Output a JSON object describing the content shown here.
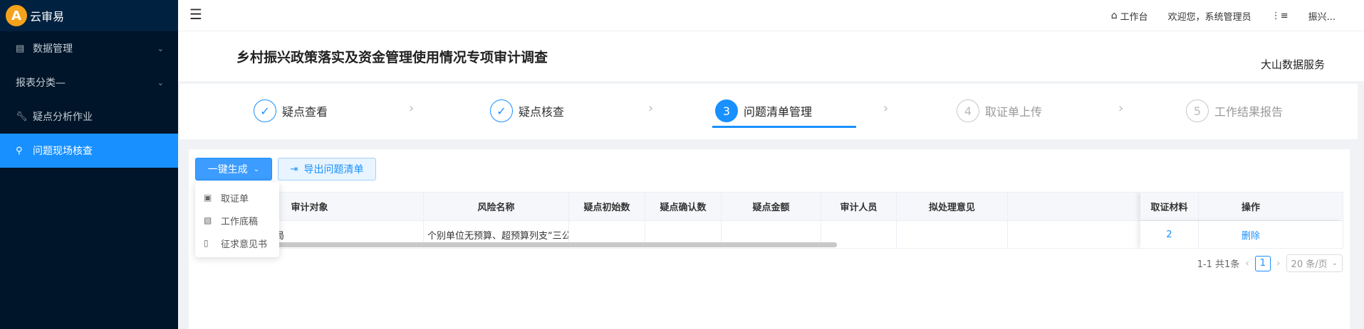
{
  "sidebar": {
    "logo_text": "云审易",
    "items": [
      {
        "label": "数据管理",
        "has_arrow": true
      },
      {
        "label": "报表分类—",
        "has_arrow": true
      },
      {
        "label": "疑点分析作业",
        "has_arrow": false
      },
      {
        "label": "问题现场核查",
        "has_arrow": false,
        "active": true
      }
    ]
  },
  "header": {
    "workbench": "工作台",
    "welcome": "欢迎您，系统管理员",
    "username": "振兴..."
  },
  "page": {
    "title": "乡村振兴政策落实及资金管理使用情况专项审计调查",
    "company": "大山数据服务"
  },
  "steps": [
    {
      "num": "✓",
      "label": "疑点查看",
      "state": "done"
    },
    {
      "num": "✓",
      "label": "疑点核查",
      "state": "done"
    },
    {
      "num": "3",
      "label": "问题清单管理",
      "state": "current"
    },
    {
      "num": "4",
      "label": "取证单上传",
      "state": "wait"
    },
    {
      "num": "5",
      "label": "工作结果报告",
      "state": "wait"
    }
  ],
  "toolbar": {
    "generate_label": "一键生成",
    "export_label": "导出问题清单"
  },
  "dropdown": {
    "items": [
      "取证单",
      "工作底稿",
      "征求意见书"
    ]
  },
  "table": {
    "columns": [
      "审计对象",
      "风险名称",
      "疑点初始数",
      "疑点确认数",
      "疑点金额",
      "审计人员",
      "拟处理意见",
      "取证材料",
      "操作"
    ],
    "rows": [
      {
        "audit_object": "政局",
        "risk_name": "个别单位无预算、超预算列支“三公”经",
        "initial": "",
        "confirmed": "",
        "amount": "",
        "auditor": "",
        "opinion": "",
        "evidence": "2",
        "action": "删除"
      }
    ]
  },
  "pagination": {
    "summary": "1-1 共1条",
    "current_page": "1",
    "page_size": "20 条/页"
  },
  "colors": {
    "primary": "#1890ff",
    "sidebar_bg": "#001529"
  }
}
